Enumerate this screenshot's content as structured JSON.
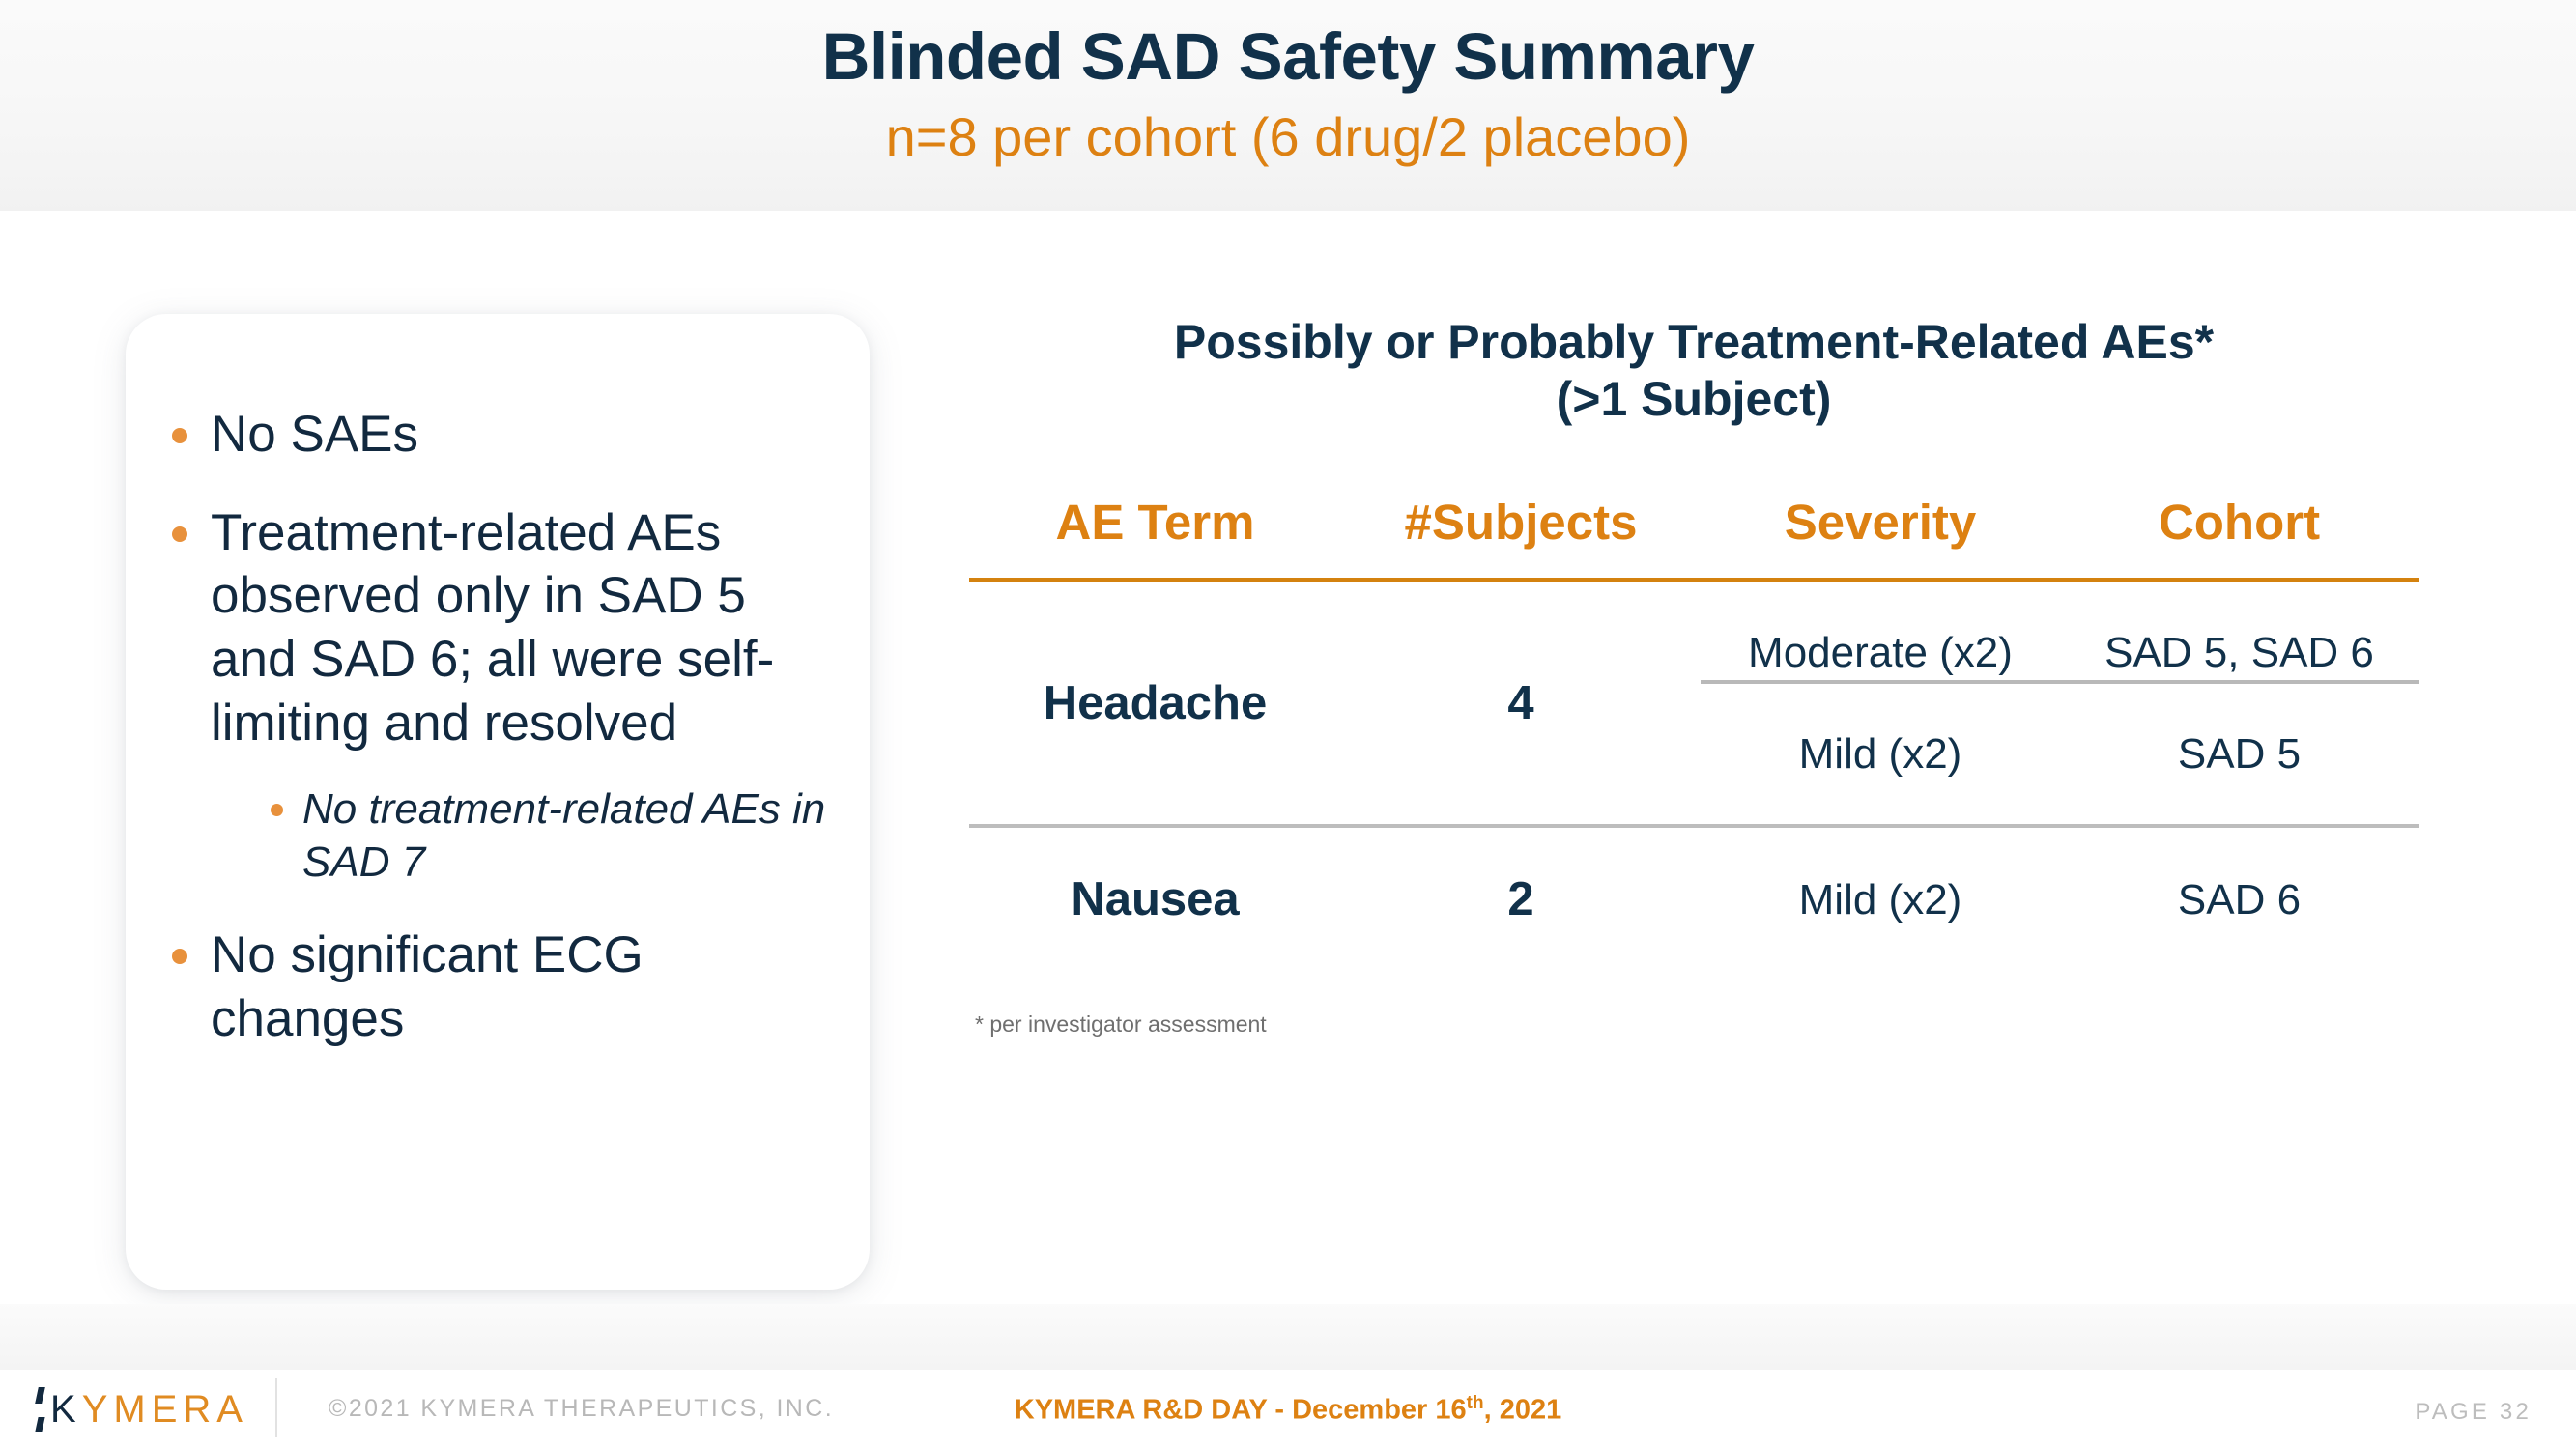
{
  "header": {
    "title": "Blinded SAD Safety Summary",
    "subtitle": "n=8 per cohort (6 drug/2 placebo)"
  },
  "colors": {
    "navy": "#11314a",
    "orange": "#dd8112",
    "bullet_orange": "#e8913c",
    "rule_gray": "#bdbdbd",
    "muted_gray": "#b8b8b8"
  },
  "left_panel": {
    "bullets": [
      {
        "text": "No SAEs"
      },
      {
        "text": "Treatment-related AEs observed only in SAD 5 and SAD 6; all were self-limiting and resolved",
        "sub_bullets": [
          {
            "text": "No treatment-related AEs in SAD 7"
          }
        ]
      },
      {
        "text": "No significant ECG changes"
      }
    ]
  },
  "table_panel": {
    "heading_line1": "Possibly or Probably Treatment-Related AEs*",
    "heading_line2": "(>1 Subject)",
    "columns": [
      "AE Term",
      "#Subjects",
      "Severity",
      "Cohort"
    ],
    "rows": [
      {
        "term": "Headache",
        "subjects": "4",
        "details": [
          {
            "severity": "Moderate (x2)",
            "cohort": "SAD 5, SAD 6"
          },
          {
            "severity": "Mild (x2)",
            "cohort": "SAD 5"
          }
        ]
      },
      {
        "term": "Nausea",
        "subjects": "2",
        "details": [
          {
            "severity": "Mild (x2)",
            "cohort": "SAD 6"
          }
        ]
      }
    ],
    "footnote": "* per investigator assessment"
  },
  "footer": {
    "logo_k": "K",
    "logo_rest": "YMERA",
    "copyright": "©2021 KYMERA THERAPEUTICS, INC.",
    "event_prefix": "KYMERA R&D DAY - December 16",
    "event_superscript": "th",
    "event_suffix": ", 2021",
    "page": "PAGE 32"
  }
}
